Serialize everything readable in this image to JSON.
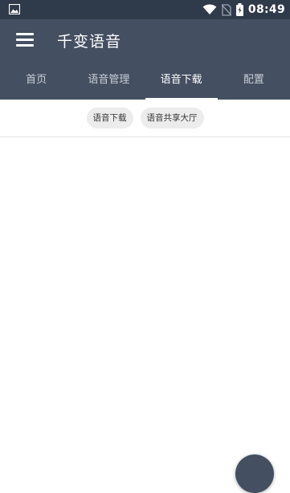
{
  "status_bar": {
    "time": "08:49",
    "icons": [
      "image-icon",
      "wifi-icon",
      "no-sim-icon",
      "battery-icon"
    ]
  },
  "app_bar": {
    "title": "千变语音",
    "menu_icon": "hamburger-menu-icon"
  },
  "tabs": [
    {
      "label": "首页",
      "active": false
    },
    {
      "label": "语音管理",
      "active": false
    },
    {
      "label": "语音下载",
      "active": true
    },
    {
      "label": "配置",
      "active": false
    }
  ],
  "chips": [
    {
      "label": "语音下载"
    },
    {
      "label": "语音共享大厅"
    }
  ],
  "colors": {
    "status_bar": "#2f3a4a",
    "primary": "#444f61",
    "chip_bg": "#ececec"
  }
}
